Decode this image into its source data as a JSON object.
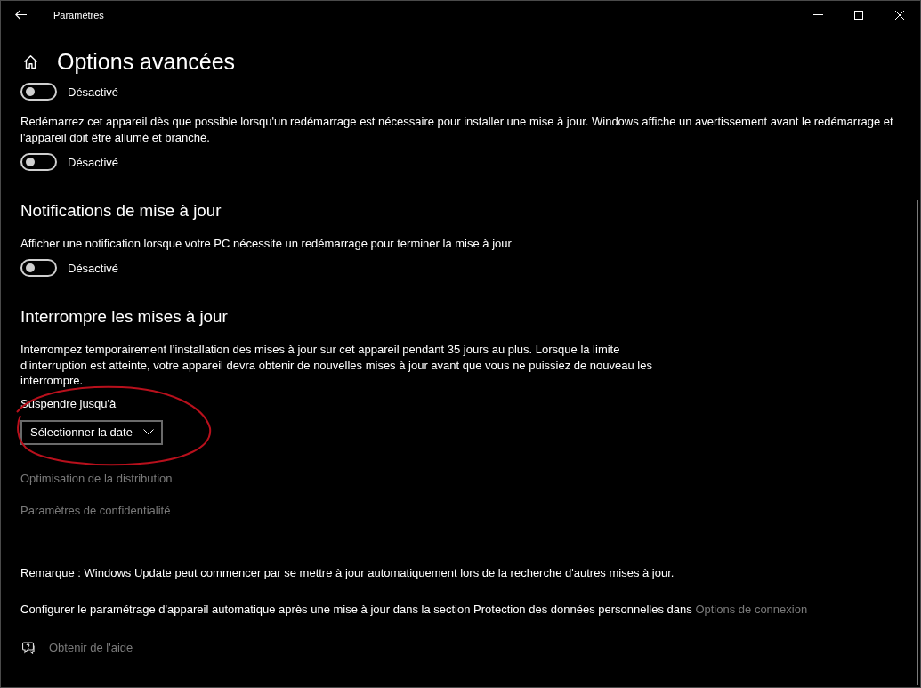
{
  "window": {
    "title": "Paramètres"
  },
  "page": {
    "title": "Options avancées"
  },
  "settings": [
    {
      "toggle": {
        "on": false,
        "label": "Désactivé"
      }
    },
    {
      "description": "Redémarrez cet appareil dès que possible lorsqu'un redémarrage est nécessaire pour installer une mise à jour. Windows affiche un avertissement avant le redémarrage et l'appareil doit être allumé et branché.",
      "toggle": {
        "on": false,
        "label": "Désactivé"
      }
    }
  ],
  "sections": [
    {
      "heading": "Notifications de mise à jour",
      "description": "Afficher une notification lorsque votre PC nécessite un redémarrage pour terminer la mise à jour",
      "toggle": {
        "on": false,
        "label": "Désactivé"
      }
    },
    {
      "heading": "Interrompre les mises à jour",
      "description": "Interrompez temporairement l’installation des mises à jour sur cet appareil pendant 35 jours au plus. Lorsque la limite d'interruption est atteinte, votre appareil devra obtenir de nouvelles mises à jour avant que vous ne puissiez de nouveau les interrompre.",
      "dropdown": {
        "label": "Suspendre jusqu'à",
        "value": "Sélectionner la date"
      }
    }
  ],
  "links": [
    "Optimisation de la distribution",
    "Paramètres de confidentialité"
  ],
  "notes": [
    {
      "text": "Remarque : Windows Update peut commencer par se mettre à jour automatiquement lors de la recherche d'autres mises à jour."
    },
    {
      "text": "Configurer le paramétrage d'appareil automatique après une mise à jour dans la section Protection des données personnelles dans",
      "link": "Options de connexion"
    }
  ],
  "help": {
    "label": "Obtenir de l'aide"
  }
}
